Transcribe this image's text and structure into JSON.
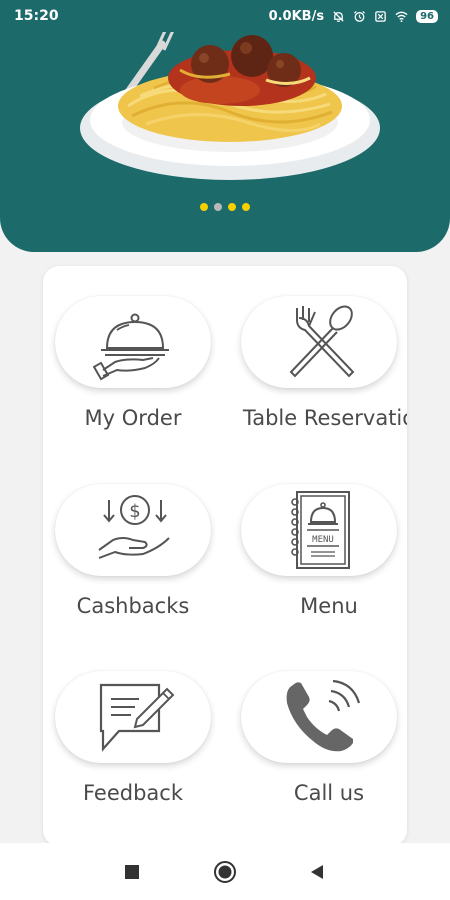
{
  "status_bar": {
    "time": "15:20",
    "network_speed": "0.0KB/s",
    "battery": "96",
    "icons": [
      "bell-off-icon",
      "alarm-icon",
      "sim-icon",
      "wifi-icon",
      "battery-icon"
    ]
  },
  "hero": {
    "image": "spaghetti-plate-image",
    "dots": [
      {
        "state": "active",
        "color": "#f5d000"
      },
      {
        "state": "inactive",
        "color": "#b9b9b9"
      },
      {
        "state": "active",
        "color": "#f5d000"
      },
      {
        "state": "active",
        "color": "#f5d000"
      }
    ]
  },
  "menu": {
    "items": [
      {
        "id": "my-order",
        "label": "My Order",
        "icon": "cloche-serving-icon"
      },
      {
        "id": "table-reservation",
        "label": "Table Reservatio",
        "icon": "fork-spoon-icon"
      },
      {
        "id": "cashbacks",
        "label": "Cashbacks",
        "icon": "cashback-hand-icon"
      },
      {
        "id": "menu",
        "label": "Menu",
        "icon": "menu-book-icon"
      },
      {
        "id": "feedback",
        "label": "Feedback",
        "icon": "feedback-note-icon"
      },
      {
        "id": "call-us",
        "label": "Call us",
        "icon": "phone-icon"
      }
    ]
  },
  "nav_bar": {
    "buttons": [
      "recents-square-icon",
      "home-circle-icon",
      "back-triangle-icon"
    ]
  },
  "colors": {
    "accent": "#1d6a6b",
    "background": "#f2f2f2",
    "icon_stroke": "#555555",
    "label": "#4a4a4a",
    "dot_active": "#f5d000",
    "dot_inactive": "#b9b9b9"
  }
}
